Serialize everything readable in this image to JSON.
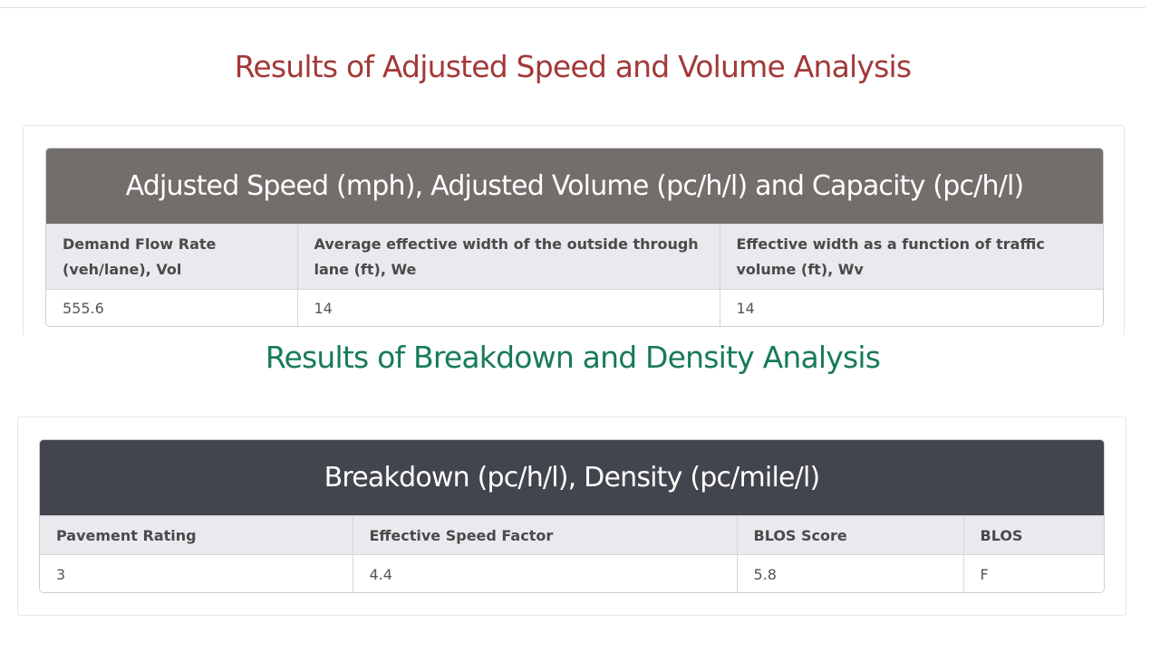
{
  "section1": {
    "title": "Results of Adjusted Speed and Volume Analysis",
    "panel_title": "Adjusted Speed (mph), Adjusted Volume (pc/h/l) and Capacity (pc/h/l)",
    "columns": [
      "Demand Flow Rate (veh/lane), Vol",
      "Average effective width of the outside through lane (ft), We",
      "Effective width as a function of traffic volume (ft), Wv"
    ],
    "row": [
      "555.6",
      "14",
      "14"
    ]
  },
  "section2": {
    "title": "Results of Breakdown and Density Analysis",
    "panel_title": "Breakdown (pc/h/l), Density (pc/mile/l)",
    "columns": [
      "Pavement Rating",
      "Effective Speed Factor",
      "BLOS Score",
      "BLOS"
    ],
    "row": [
      "3",
      "4.4",
      "5.8",
      "F"
    ]
  },
  "colors": {
    "title1": "#a33838",
    "title2": "#177a5c",
    "panel1_header": "#736e6c",
    "panel2_header": "#43454e",
    "table_header_bg": "#e9e9ee"
  }
}
